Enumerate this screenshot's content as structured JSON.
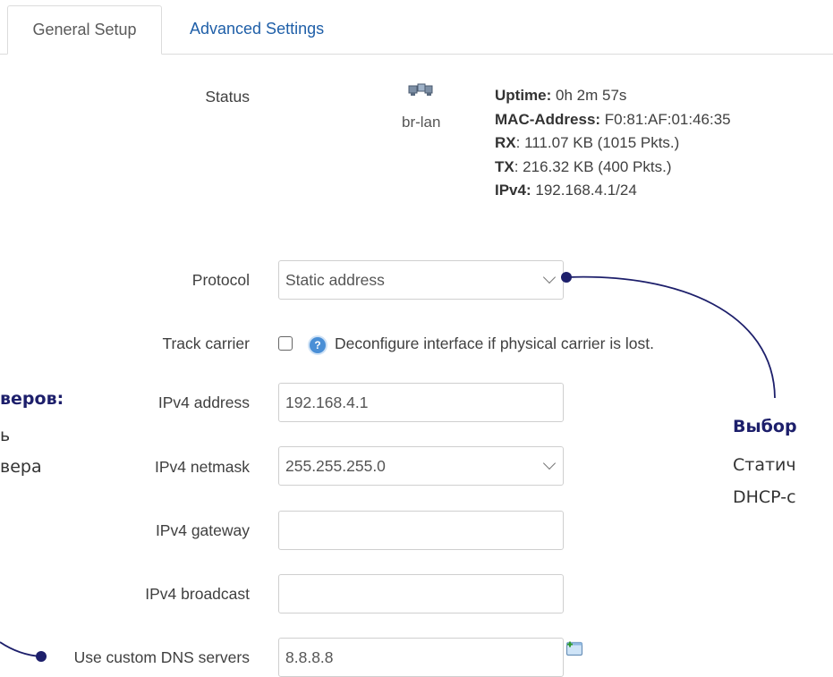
{
  "tabs": [
    {
      "label": "General Setup",
      "active": true
    },
    {
      "label": "Advanced Settings",
      "active": false
    }
  ],
  "status": {
    "label": "Status",
    "interface": "br-lan",
    "interface_icon": "network-bridge-icon",
    "uptime_key": "Uptime:",
    "uptime_value": "0h 2m 57s",
    "mac_key": "MAC-Address:",
    "mac_value": "F0:81:AF:01:46:35",
    "rx_key": "RX",
    "rx_value": ": 111.07 KB (1015 Pkts.)",
    "tx_key": "TX",
    "tx_value": ": 216.32 KB (400 Pkts.)",
    "ipv4_key": "IPv4:",
    "ipv4_value": "192.168.4.1/24"
  },
  "protocol": {
    "label": "Protocol",
    "value": "Static address"
  },
  "track_carrier": {
    "label": "Track carrier",
    "checked": false,
    "help": "Deconfigure interface if physical carrier is lost."
  },
  "ipv4_address": {
    "label": "IPv4 address",
    "value": "192.168.4.1"
  },
  "ipv4_netmask": {
    "label": "IPv4 netmask",
    "value": "255.255.255.0"
  },
  "ipv4_gateway": {
    "label": "IPv4 gateway",
    "value": ""
  },
  "ipv4_broadcast": {
    "label": "IPv4 broadcast",
    "value": ""
  },
  "dns": {
    "label": "Use custom DNS servers",
    "value": "8.8.8.8",
    "add_icon": "add-entry-icon"
  },
  "annotations": {
    "left_bold": "веров:",
    "left_line2": "ь",
    "left_line3": "вера",
    "right_bold": "Выбор",
    "right_line2": "Статич",
    "right_line3": "DHCP-с"
  },
  "colors": {
    "accent": "#1f5fa8",
    "annotation": "#1d1f6b"
  }
}
